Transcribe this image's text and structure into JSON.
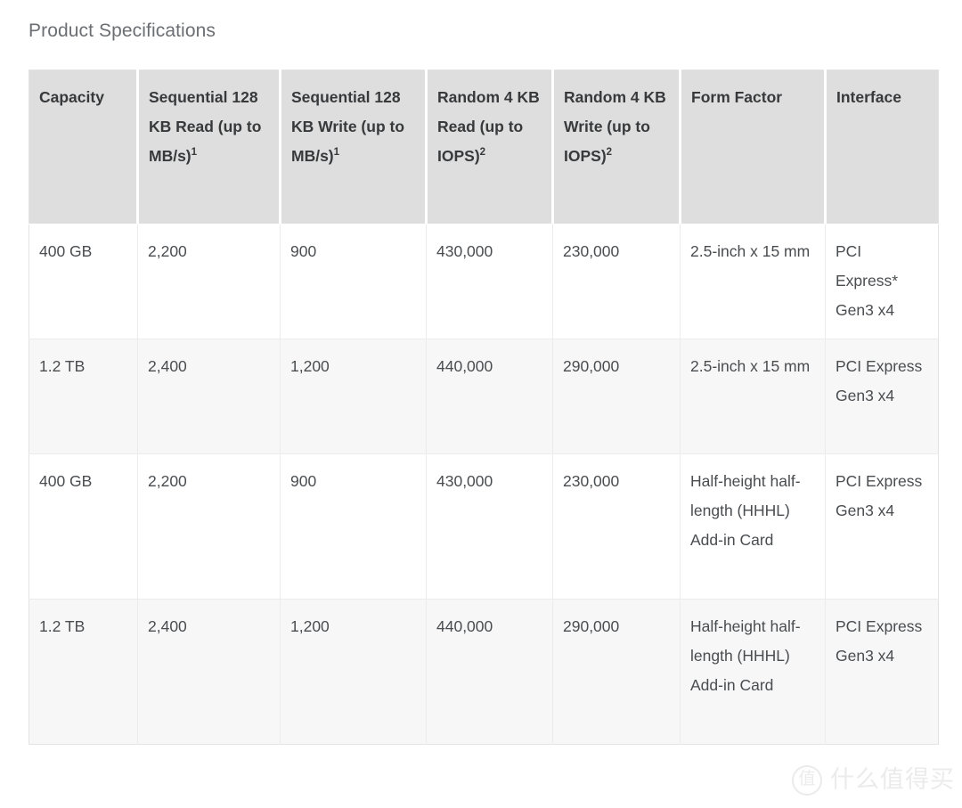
{
  "page": {
    "title": "Product Specifications",
    "background_color": "#ffffff"
  },
  "colors": {
    "header_background": "#dedede",
    "header_text": "#37393b",
    "body_text": "#4a4d50",
    "title_text": "#6b6f73",
    "row_stripe": "#f7f7f7",
    "table_border": "#e3e3e3"
  },
  "table": {
    "columns": [
      {
        "label": "Capacity",
        "footnote": ""
      },
      {
        "label": "Sequential 128 KB Read (up to MB/s)",
        "footnote": "1"
      },
      {
        "label": "Sequential 128 KB Write (up to MB/s)",
        "footnote": "1"
      },
      {
        "label": "Random 4 KB Read (up to IOPS)",
        "footnote": "2"
      },
      {
        "label": "Random 4 KB Write (up to IOPS)",
        "footnote": "2"
      },
      {
        "label": "Form Factor",
        "footnote": ""
      },
      {
        "label": "Interface",
        "footnote": ""
      }
    ],
    "rows": [
      {
        "capacity": "400 GB",
        "seq_read": "2,200",
        "seq_write": "900",
        "rand_read": "430,000",
        "rand_write": "230,000",
        "form_factor": "2.5-inch x 15 mm",
        "interface": "PCI Express* Gen3 x4"
      },
      {
        "capacity": "1.2 TB",
        "seq_read": "2,400",
        "seq_write": "1,200",
        "rand_read": "440,000",
        "rand_write": "290,000",
        "form_factor": "2.5-inch x 15 mm",
        "interface": "PCI Express Gen3 x4"
      },
      {
        "capacity": "400 GB",
        "seq_read": "2,200",
        "seq_write": "900",
        "rand_read": "430,000",
        "rand_write": "230,000",
        "form_factor": "Half-height half-length (HHHL) Add-in Card",
        "interface": "PCI Express Gen3 x4"
      },
      {
        "capacity": "1.2 TB",
        "seq_read": "2,400",
        "seq_write": "1,200",
        "rand_read": "440,000",
        "rand_write": "290,000",
        "form_factor": "Half-height half-length (HHHL) Add-in Card",
        "interface": "PCI Express Gen3 x4"
      }
    ]
  },
  "watermark": {
    "logo_glyph": "值",
    "text": "什么值得买",
    "color": "#ebebeb"
  }
}
